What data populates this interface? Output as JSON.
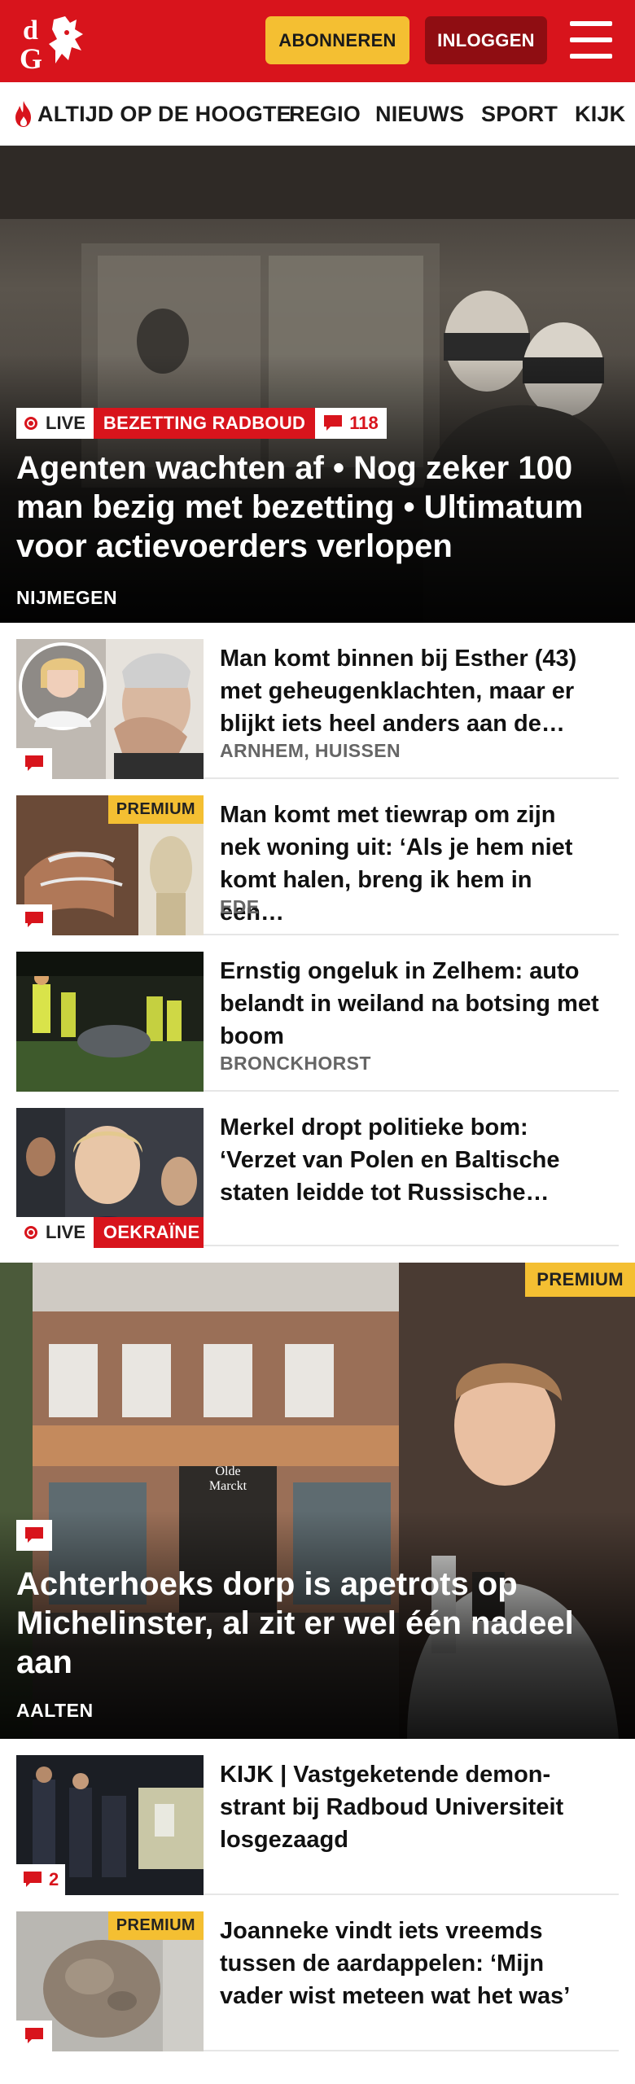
{
  "header": {
    "logo_text": "dG",
    "subscribe_label": "ABONNEREN",
    "login_label": "INLOGGEN",
    "menu_icon": "hamburger-menu-icon",
    "brand_color": "#d8141c",
    "subscribe_color": "#f4bf32",
    "login_color": "#8f0d12"
  },
  "nav": {
    "items": [
      {
        "label": "ALTIJD OP DE HOOGTE",
        "icon": "flame-icon"
      },
      {
        "label": "REGIO"
      },
      {
        "label": "NIEUWS"
      },
      {
        "label": "SPORT"
      },
      {
        "label": "KIJK"
      }
    ]
  },
  "hero": {
    "live_label": "LIVE",
    "tag": "BEZETTING RADBOUD",
    "comments": "118",
    "title": "Agenten wachten af • Nog zeker 100 man bezig met bezetting • Ultimatum voor actievoerders verlopen",
    "location": "NIJMEGEN"
  },
  "articles": [
    {
      "title": "Man komt binnen bij Esther (43) met geheugenklachten, maar er blijkt iets heel anders aan de…",
      "location": "ARNHEM, HUISSEN",
      "premium": "",
      "comments": ""
    },
    {
      "title": "Man komt met tiewrap om zijn nek woning uit: ‘Als je hem niet komt halen, breng ik hem in een…",
      "location": "EDE",
      "premium": "PREMIUM",
      "comments": ""
    },
    {
      "title": "Ernstig ongeluk in Zelhem: auto belandt in weiland na botsing met boom",
      "location": "BRONCKHORST",
      "premium": "",
      "comments": ""
    },
    {
      "title": "Merkel dropt politieke bom: ‘Verzet van Polen en Baltische staten leidde tot Russische…",
      "location": "",
      "live_label": "LIVE",
      "tag": "OEKRAÏNE"
    }
  ],
  "big_card": {
    "premium": "PREMIUM",
    "title": "Achterhoeks dorp is apetrots op Michelinster, al zit er wel één nadeel aan",
    "location": "AALTEN",
    "sign_text": "Olde Marckt"
  },
  "articles2": [
    {
      "title": "KIJK | Vastgeketende demon­strant bij Radboud Universiteit losgezaagd",
      "comments": "2"
    },
    {
      "title": "Joanneke vindt iets vreemds tussen de aardappelen: ‘Mijn vader wist meteen wat het was’",
      "premium": "PREMIUM"
    }
  ]
}
